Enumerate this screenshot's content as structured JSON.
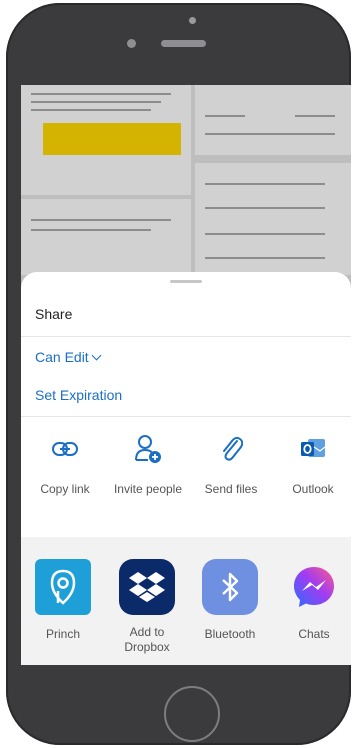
{
  "sheet": {
    "title": "Share",
    "permission_label": "Can Edit",
    "expiration_label": "Set Expiration"
  },
  "actions": [
    {
      "label": "Copy link",
      "icon": "link-icon"
    },
    {
      "label": "Invite people",
      "icon": "invite-people-icon"
    },
    {
      "label": "Send files",
      "icon": "paperclip-icon"
    },
    {
      "label": "Outlook",
      "icon": "outlook-icon"
    }
  ],
  "apps": [
    {
      "label": "Princh",
      "icon": "princh-icon",
      "color": "#1e9fd8"
    },
    {
      "label": "Add to Dropbox",
      "icon": "dropbox-icon",
      "color": "#0b2a6a"
    },
    {
      "label": "Bluetooth",
      "icon": "bluetooth-icon",
      "color": "#6f8fe0"
    },
    {
      "label": "Chats",
      "icon": "messenger-icon",
      "color": "#ffffff"
    }
  ],
  "colors": {
    "accent": "#1a6fc4",
    "phone_body": "#3b3b3e"
  }
}
